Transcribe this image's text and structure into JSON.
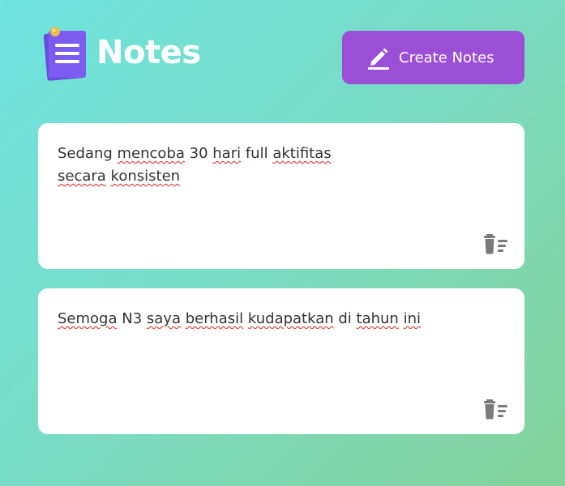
{
  "app": {
    "title": "Notes",
    "logo_icon": "notes-stack-icon"
  },
  "toolbar": {
    "create_label": "Create Notes",
    "create_icon": "pencil-edit-icon"
  },
  "notes": [
    {
      "lines": [
        [
          {
            "text": "Sedang ",
            "misspelled": false
          },
          {
            "text": "mencoba",
            "misspelled": true
          },
          {
            "text": " 30 ",
            "misspelled": false
          },
          {
            "text": "hari",
            "misspelled": true
          },
          {
            "text": " full ",
            "misspelled": false
          },
          {
            "text": "aktifitas",
            "misspelled": true
          }
        ],
        [
          {
            "text": "secara",
            "misspelled": true
          },
          {
            "text": " ",
            "misspelled": false
          },
          {
            "text": "konsisten",
            "misspelled": true
          }
        ]
      ],
      "delete_icon": "trash-delete-icon"
    },
    {
      "lines": [
        [
          {
            "text": "Semoga",
            "misspelled": true
          },
          {
            "text": " N3 ",
            "misspelled": false
          },
          {
            "text": "saya",
            "misspelled": true
          },
          {
            "text": " ",
            "misspelled": false
          },
          {
            "text": "berhasil",
            "misspelled": true
          },
          {
            "text": " ",
            "misspelled": false
          },
          {
            "text": "kudapatkan",
            "misspelled": true
          },
          {
            "text": " di ",
            "misspelled": false
          },
          {
            "text": "tahun",
            "misspelled": true
          },
          {
            "text": " ",
            "misspelled": false
          },
          {
            "text": "ini",
            "misspelled": true
          }
        ]
      ],
      "delete_icon": "trash-delete-icon"
    }
  ],
  "colors": {
    "accent": "#9b4fd6",
    "spellcheck": "#e0241f",
    "card": "#ffffff",
    "icon_gray": "#7a7a7a"
  }
}
